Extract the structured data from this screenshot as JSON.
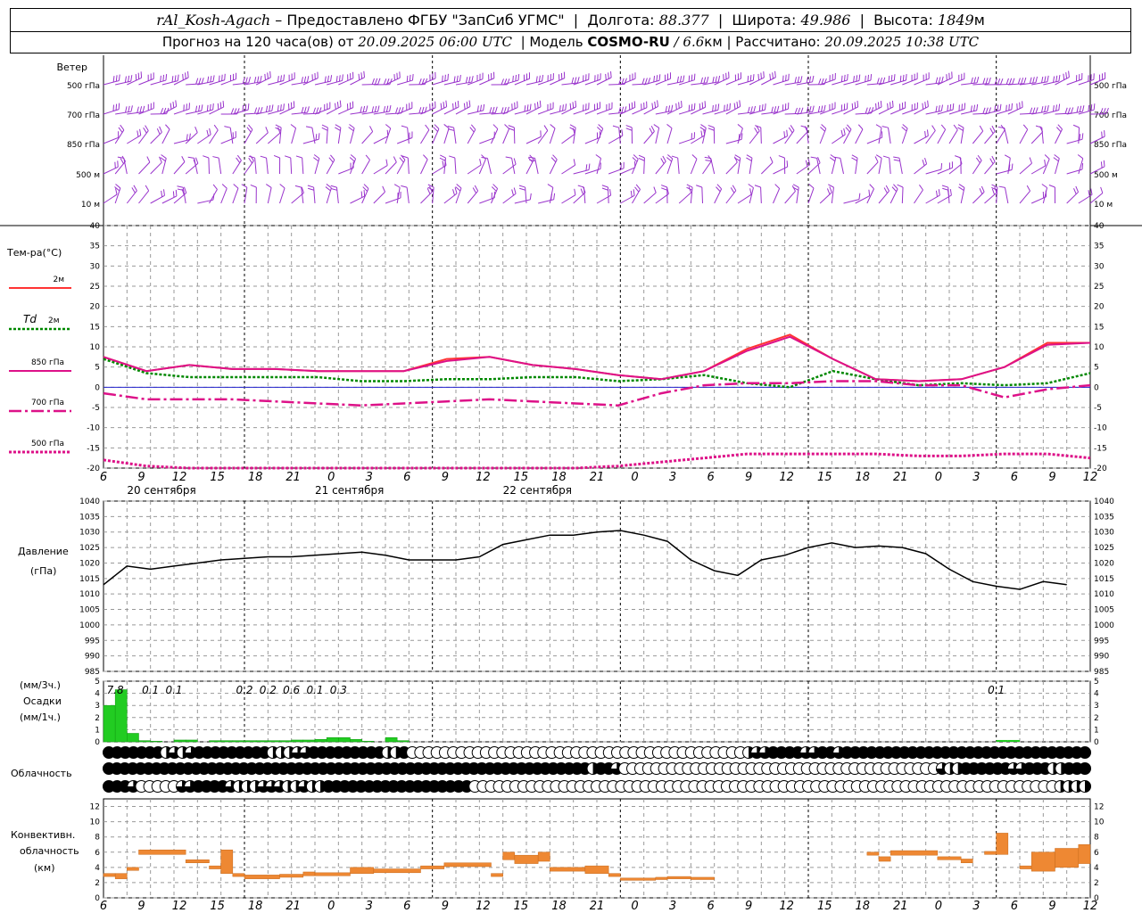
{
  "header": {
    "station": "rAl_Kosh-Agach",
    "provider_sep": " – ",
    "provider": "Предоставлено ФГБУ \"ЗапСиб УГМС\"",
    "lon_label": "Долгота:",
    "lon": "88.377",
    "lat_label": "Широта:",
    "lat": "49.986",
    "alt_label": "Высота:",
    "alt": "1849",
    "alt_unit": "м",
    "forecast_label": "Прогноз на 120 часа(ов)  от",
    "forecast_start": "20.09.2025 06:00 UTC",
    "model_label": "Модель",
    "model": "COSMO-RU",
    "model_res": "/ 6.6",
    "model_res_unit": "км",
    "calc_label": "Рассчитано:",
    "calc_time": "20.09.2025 10:38 UTC"
  },
  "colors": {
    "wind": "#9933cc",
    "t2m": "#ff3333",
    "td2m": "#008800",
    "t850": "#dd1188",
    "t700": "#dd1188",
    "t500": "#dd1188",
    "zero_line": "#2222cc",
    "pressure": "#000000",
    "precip": "#22cc22",
    "convective": "#ee8833",
    "grid": "#999999"
  },
  "chart_data": [
    {
      "type": "wind_barbs",
      "panel_title": "Ветер",
      "levels": [
        "500 гПа",
        "700 гПа",
        "850 гПа",
        "500 м",
        "10 м"
      ]
    },
    {
      "type": "line",
      "panel_title": "Тем-ра(°C)",
      "ylim": [
        -20,
        40
      ],
      "y_ticks": [
        -20,
        -15,
        -10,
        -5,
        0,
        5,
        10,
        15,
        20,
        25,
        30,
        35,
        40
      ],
      "x_hours": [
        0,
        6,
        12,
        18,
        24,
        30,
        36,
        42,
        48,
        54,
        60,
        66,
        72,
        78,
        84,
        90,
        96,
        102,
        108,
        114,
        120,
        126
      ],
      "series": [
        {
          "name": "2м",
          "values": [
            7.5,
            4,
            5.5,
            4.5,
            4.5,
            4,
            4,
            4,
            7,
            7.5,
            5.5,
            4.5,
            3,
            2,
            4,
            9.5,
            13,
            7,
            2,
            1.5,
            2,
            5,
            11,
            11
          ]
        },
        {
          "name": "Td  2м",
          "values": [
            7,
            3.5,
            2.5,
            2.5,
            2.5,
            2.5,
            1.5,
            1.5,
            2,
            2,
            2.5,
            2.5,
            1.5,
            2,
            3,
            1,
            0,
            4,
            2,
            0.5,
            1,
            0.5,
            1,
            3.5
          ]
        },
        {
          "name": "850 гПа",
          "values": [
            7.5,
            4,
            5.5,
            4.5,
            4.5,
            4,
            4,
            4,
            6.5,
            7.5,
            5.5,
            4.5,
            3,
            2,
            4,
            9,
            12.5,
            7,
            2,
            1.5,
            2,
            5,
            10.5,
            11
          ]
        },
        {
          "name": "700 гПа",
          "values": [
            -1.5,
            -3,
            -3,
            -3,
            -3.5,
            -4,
            -4.5,
            -4,
            -3.5,
            -3,
            -3.5,
            -4,
            -4.5,
            -1.5,
            0.5,
            1,
            1,
            1.5,
            1.5,
            0.5,
            0.5,
            -2.5,
            -0.5,
            0.5
          ]
        },
        {
          "name": "500 гПа",
          "values": [
            -18,
            -19.5,
            -21,
            -21,
            -21,
            -21,
            -21,
            -21,
            -21,
            -21,
            -21,
            -21,
            -19.5,
            -18.5,
            -17.5,
            -16.5,
            -16.5,
            -16.5,
            -16.5,
            -17,
            -17,
            -16.5,
            -16.5,
            -17.5
          ]
        }
      ]
    },
    {
      "type": "line",
      "panel_title": "Давление",
      "unit": "(гПа)",
      "ylim": [
        985,
        1040
      ],
      "y_ticks": [
        985,
        990,
        995,
        1000,
        1005,
        1010,
        1015,
        1020,
        1025,
        1030,
        1035,
        1040
      ],
      "x": [
        0,
        3,
        6,
        9,
        12,
        15,
        18,
        21,
        24,
        27,
        30,
        33,
        36,
        39,
        42,
        45,
        48,
        51,
        54,
        57,
        60,
        63,
        66,
        69,
        72,
        75,
        78,
        81,
        84,
        87,
        90,
        93,
        96,
        99,
        102,
        105,
        108,
        111,
        114,
        117,
        120,
        123,
        126
      ],
      "values": [
        1013,
        1019,
        1018,
        1019,
        1020,
        1021,
        1021.5,
        1022,
        1022,
        1022.5,
        1023,
        1023.5,
        1022.5,
        1021,
        1021,
        1021,
        1022,
        1026,
        1027.5,
        1029,
        1029,
        1030,
        1030.5,
        1029,
        1027,
        1021,
        1017.5,
        1016,
        1021,
        1022.5,
        1025,
        1026.5,
        1025,
        1025.5,
        1025,
        1023,
        1018,
        1014,
        1012.5,
        1011.5,
        1014,
        1013
      ]
    },
    {
      "type": "bar",
      "panel_title": "Осадки",
      "unit_top": "(мм/3ч.)",
      "unit_bottom": "(мм/1ч.)",
      "ylim": [
        0,
        5
      ],
      "y_ticks": [
        0,
        1,
        2,
        3,
        4,
        5
      ],
      "x_start": 0,
      "bar_width_hours": 1.5,
      "values": [
        3,
        4.3,
        0.7,
        0.1,
        0.05,
        0,
        0.15,
        0.15,
        0,
        0.1,
        0.1,
        0.1,
        0.1,
        0.1,
        0.1,
        0.1,
        0.15,
        0.15,
        0.2,
        0.35,
        0.35,
        0.2,
        0.05,
        0,
        0.35,
        0.1,
        0
      ],
      "labels": [
        {
          "hour": 1.5,
          "text": "7.8"
        },
        {
          "hour": 6,
          "text": "0.1"
        },
        {
          "hour": 9,
          "text": "0.1"
        },
        {
          "hour": 18,
          "text": "0.2"
        },
        {
          "hour": 21,
          "text": "0.2"
        },
        {
          "hour": 24,
          "text": "0.6"
        },
        {
          "hour": 27,
          "text": "0.1"
        },
        {
          "hour": 30,
          "text": "0.3"
        },
        {
          "hour": 114,
          "text": "0.1"
        }
      ]
    },
    {
      "type": "heatmap",
      "panel_title": "Облачность",
      "rows": [
        "FFFFFFFHTHTFFFFFFFFFHHHTTFFFFFFFFFHHFEEEEEEEEEEEEEEEEEEEEEEEEEEEEEEEEEEEEEEEEEHTTFFFFTTFFTFFFFFFFFFFFFFFFFFFFFFFFFFFFFFF",
        "FFFFFFFFFFFFFFFFFFFFFFFFFFFFFFFFFFFFFFFFFFFFFFFFFFFFFFFFFFFFFHFFTEEEEEEEEEEEEEEEEEEEEEEEEEEEEEEEEEEEEEEEETHHFFFFFFTTFFFHHFFF",
        "FFFTEEEEETTFFFFTHHHTTTHHTHHFFFFFFFFFFFFFFFFFFEEEEEEEEEEEEEEEEEEEEEEEEEEEEEEEEEEEEEEEEEEEEEEEEEEEEEEEEEEEEEEEEEEEEEEEEHHHH"
      ],
      "legend_note": "F = overcast, T = three-quarter, H = half, E = clear"
    },
    {
      "type": "bar",
      "panel_title": "Конвективн. облачность (км)",
      "ylim": [
        0,
        13
      ],
      "y_ticks": [
        0,
        2,
        4,
        6,
        8,
        10,
        12
      ],
      "segments": [
        [
          0,
          1.5,
          2.8,
          3.2
        ],
        [
          1.5,
          3,
          2.5,
          3.2
        ],
        [
          3,
          4.5,
          3.6,
          4
        ],
        [
          4.5,
          10.5,
          5.7,
          6.3
        ],
        [
          10.5,
          13.5,
          4.6,
          5
        ],
        [
          13.5,
          15,
          3.8,
          4.2
        ],
        [
          15,
          16.5,
          3.2,
          6.3
        ],
        [
          16.5,
          18,
          2.8,
          3.2
        ],
        [
          18,
          22.5,
          2.5,
          3
        ],
        [
          22.5,
          25.5,
          2.7,
          3.1
        ],
        [
          25.5,
          27,
          2.9,
          3.4
        ],
        [
          27,
          31.5,
          2.9,
          3.3
        ],
        [
          31.5,
          34.5,
          3.2,
          4
        ],
        [
          34.5,
          40.5,
          3.3,
          3.8
        ],
        [
          40.5,
          43.5,
          3.8,
          4.2
        ],
        [
          43.5,
          49.5,
          4.1,
          4.6
        ],
        [
          49.5,
          51,
          2.8,
          3.2
        ],
        [
          51,
          52.5,
          5.0,
          6.0
        ],
        [
          52.5,
          55.5,
          4.5,
          5.6
        ],
        [
          55.5,
          57,
          4.8,
          6.0
        ],
        [
          57,
          61.5,
          3.5,
          4.0
        ],
        [
          61.5,
          64.5,
          3.2,
          4.2
        ],
        [
          64.5,
          66,
          2.8,
          3.2
        ],
        [
          66,
          70.5,
          2.3,
          2.6
        ],
        [
          70.5,
          72,
          2.4,
          2.7
        ],
        [
          72,
          75,
          2.5,
          2.8
        ],
        [
          75,
          78,
          2.4,
          2.7
        ],
        [
          97.5,
          99,
          5.6,
          6.0
        ],
        [
          99,
          100.5,
          4.8,
          5.4
        ],
        [
          100.5,
          106.5,
          5.6,
          6.2
        ],
        [
          106.5,
          109.5,
          5.0,
          5.4
        ],
        [
          109.5,
          111,
          4.6,
          5.1
        ],
        [
          112.5,
          114,
          5.7,
          6.1
        ],
        [
          114,
          115.5,
          5.7,
          8.5
        ],
        [
          117,
          118.5,
          3.8,
          4.2
        ],
        [
          118.5,
          121.5,
          3.5,
          6.0
        ],
        [
          121.5,
          124.5,
          4.0,
          6.5
        ],
        [
          124.5,
          126,
          4.5,
          7.0
        ]
      ]
    }
  ],
  "x_axis": {
    "tick_labels": [
      "6",
      "9",
      "12",
      "15",
      "18",
      "21",
      "0",
      "3",
      "6",
      "9",
      "12",
      "15",
      "18",
      "21",
      "0",
      "3",
      "6",
      "9",
      "12",
      "15",
      "18",
      "21",
      "0",
      "3",
      "6",
      "9",
      "12"
    ],
    "dates": [
      {
        "hour": 3,
        "text": "20 сентября"
      },
      {
        "hour": 27,
        "text": "21 сентября"
      },
      {
        "hour": 51,
        "text": "22 сентября"
      }
    ]
  },
  "legend": {
    "t2m": "2м",
    "td2m_a": "Td",
    "td2m_b": "2м",
    "t850": "850 гПа",
    "t700": "700 гПа",
    "t500": "500 гПа"
  }
}
